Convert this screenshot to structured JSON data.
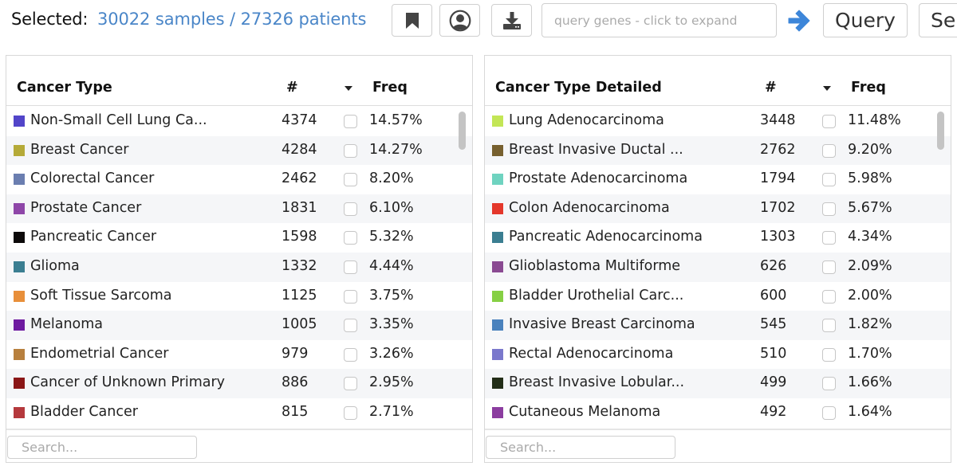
{
  "toolbar": {
    "selected_label": "Selected:",
    "selected_value": "30022 samples / 27326 patients",
    "bookmark_icon": "bookmark-icon",
    "user_icon": "user-circle-icon",
    "download_icon": "download-icon",
    "query_placeholder": "query genes - click to expand",
    "arrow_icon": "arrow-right-icon",
    "query_label": "Query",
    "next_label": "Se",
    "accent_color": "#4a86c8"
  },
  "tables": [
    {
      "headers": {
        "name": "Cancer Type",
        "count": "#",
        "freq": "Freq"
      },
      "sort_icon": "caret-down-icon",
      "search_placeholder": "Search...",
      "rows": [
        {
          "color": "#5245c9",
          "name": "Non-Small Cell Lung Ca...",
          "count": "4374",
          "freq": "14.57%",
          "checked": false
        },
        {
          "color": "#b5aa38",
          "name": "Breast Cancer",
          "count": "4284",
          "freq": "14.27%",
          "checked": false
        },
        {
          "color": "#6b7eb0",
          "name": "Colorectal Cancer",
          "count": "2462",
          "freq": "8.20%",
          "checked": false
        },
        {
          "color": "#8e46a8",
          "name": "Prostate Cancer",
          "count": "1831",
          "freq": "6.10%",
          "checked": false
        },
        {
          "color": "#0d0a0a",
          "name": "Pancreatic Cancer",
          "count": "1598",
          "freq": "5.32%",
          "checked": false
        },
        {
          "color": "#3b7e91",
          "name": "Glioma",
          "count": "1332",
          "freq": "4.44%",
          "checked": false
        },
        {
          "color": "#e88f3a",
          "name": "Soft Tissue Sarcoma",
          "count": "1125",
          "freq": "3.75%",
          "checked": false
        },
        {
          "color": "#6e1aa0",
          "name": "Melanoma",
          "count": "1005",
          "freq": "3.35%",
          "checked": false
        },
        {
          "color": "#b8803e",
          "name": "Endometrial Cancer",
          "count": "979",
          "freq": "3.26%",
          "checked": false
        },
        {
          "color": "#8a1616",
          "name": "Cancer of Unknown Primary",
          "count": "886",
          "freq": "2.95%",
          "checked": false
        },
        {
          "color": "#b5393d",
          "name": "Bladder Cancer",
          "count": "815",
          "freq": "2.71%",
          "checked": false
        }
      ]
    },
    {
      "headers": {
        "name": "Cancer Type Detailed",
        "count": "#",
        "freq": "Freq"
      },
      "sort_icon": "caret-down-icon",
      "search_placeholder": "Search...",
      "rows": [
        {
          "color": "#c3e656",
          "name": "Lung Adenocarcinoma",
          "count": "3448",
          "freq": "11.48%",
          "checked": false
        },
        {
          "color": "#77602f",
          "name": "Breast Invasive Ductal ...",
          "count": "2762",
          "freq": "9.20%",
          "checked": false
        },
        {
          "color": "#6fd3c0",
          "name": "Prostate Adenocarcinoma",
          "count": "1794",
          "freq": "5.98%",
          "checked": false
        },
        {
          "color": "#e4372b",
          "name": "Colon Adenocarcinoma",
          "count": "1702",
          "freq": "5.67%",
          "checked": false
        },
        {
          "color": "#3b7e91",
          "name": "Pancreatic Adenocarcinoma",
          "count": "1303",
          "freq": "4.34%",
          "checked": false
        },
        {
          "color": "#8a4a92",
          "name": "Glioblastoma Multiforme",
          "count": "626",
          "freq": "2.09%",
          "checked": false
        },
        {
          "color": "#86d044",
          "name": "Bladder Urothelial Carc...",
          "count": "600",
          "freq": "2.00%",
          "checked": false
        },
        {
          "color": "#4a82bd",
          "name": "Invasive Breast Carcinoma",
          "count": "545",
          "freq": "1.82%",
          "checked": false
        },
        {
          "color": "#7a78cc",
          "name": "Rectal Adenocarcinoma",
          "count": "510",
          "freq": "1.70%",
          "checked": false
        },
        {
          "color": "#232e18",
          "name": "Breast Invasive Lobular...",
          "count": "499",
          "freq": "1.66%",
          "checked": false
        },
        {
          "color": "#8c3da0",
          "name": "Cutaneous Melanoma",
          "count": "492",
          "freq": "1.64%",
          "checked": false
        }
      ]
    }
  ]
}
